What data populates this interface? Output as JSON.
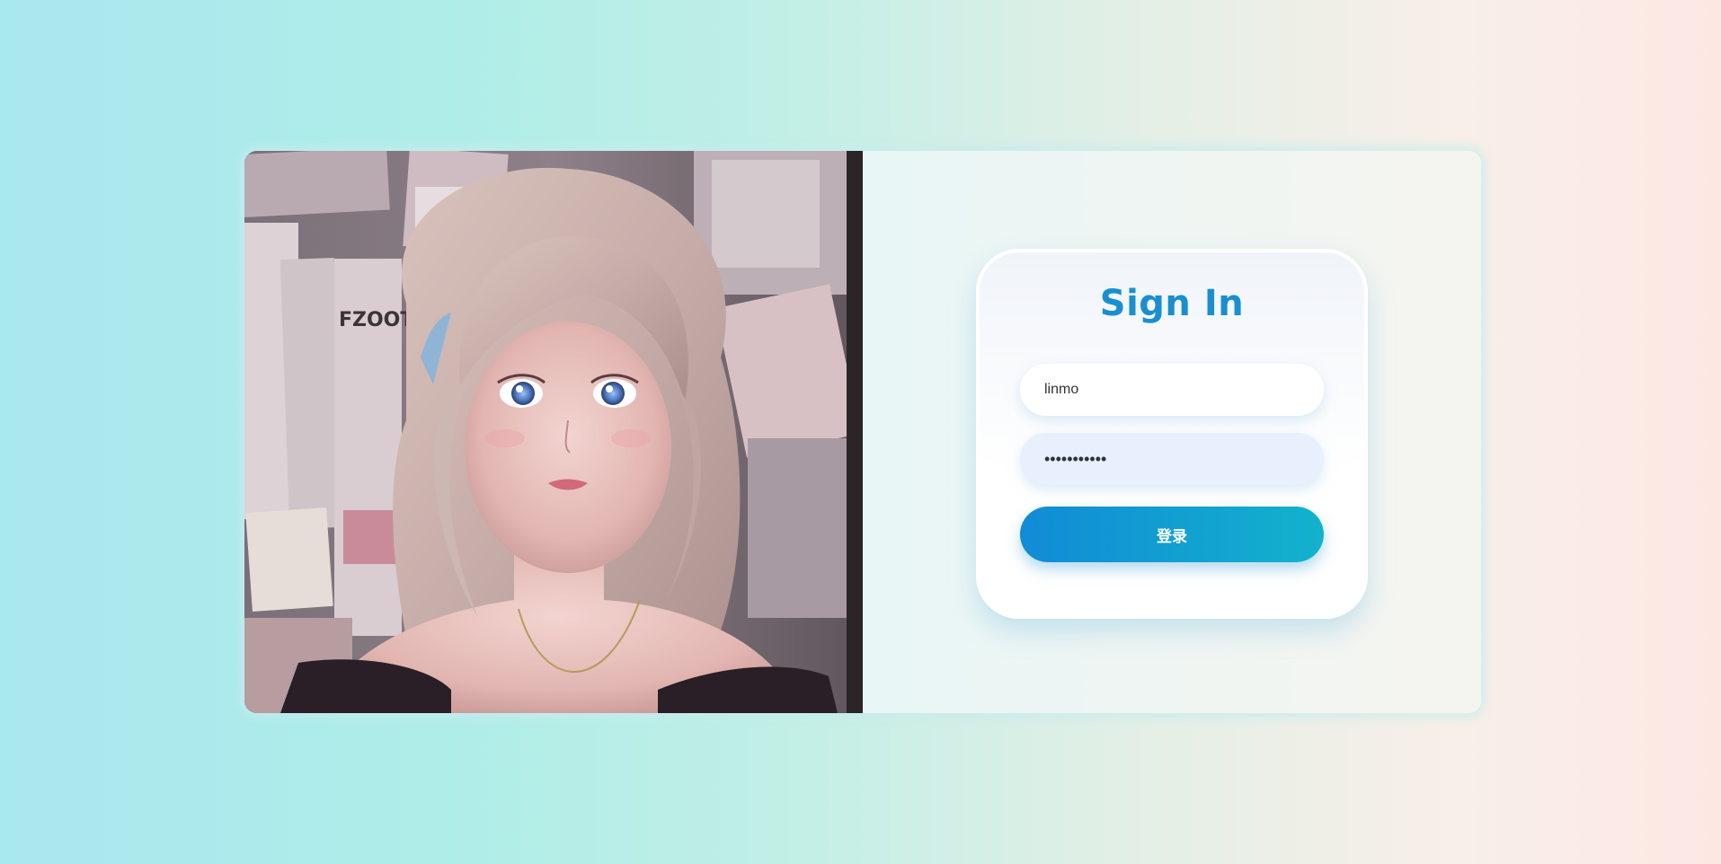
{
  "login": {
    "title": "Sign In",
    "username_value": "linmo",
    "password_value": "•••••••••••",
    "submit_label": "登录"
  },
  "colors": {
    "title": "#1a8fd0",
    "button_start": "#118bd6",
    "button_end": "#13b2cd",
    "password_field_bg": "#e8f0fd"
  }
}
